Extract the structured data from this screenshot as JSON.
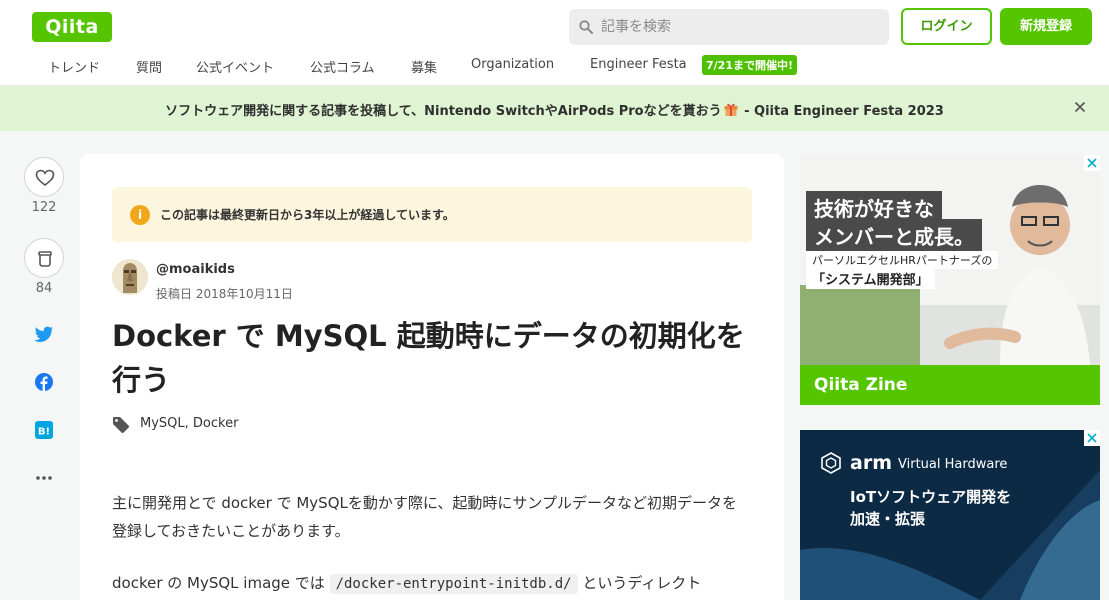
{
  "header": {
    "logo": "Qiita",
    "search_placeholder": "記事を検索",
    "login": "ログイン",
    "signup": "新規登録",
    "nav": [
      "トレンド",
      "質問",
      "公式イベント",
      "公式コラム",
      "募集",
      "Organization",
      "Engineer Festa"
    ],
    "fest_badge": "7/21まで開催中!"
  },
  "banner": {
    "text_before": "ソフトウェア開発に関する記事を投稿して、Nintendo SwitchやAirPods Proなどを貰おう",
    "text_after": " - Qiita Engineer Festa 2023"
  },
  "side": {
    "like_count": "122",
    "stock_count": "84"
  },
  "article": {
    "notice": "この記事は最終更新日から3年以上が経過しています。",
    "author": "@moaikids",
    "posted": "投稿日 2018年10月11日",
    "title": "Docker で MySQL 起動時にデータの初期化を行う",
    "tags": [
      "MySQL",
      "Docker"
    ],
    "para1": "主に開発用とで docker で MySQLを動かす際に、起動時にサンプルデータなど初期データを登録しておきたいことがあります。",
    "para2_before": "docker の MySQL image では ",
    "para2_code": "/docker-entrypoint-initdb.d/",
    "para2_after": " というディレクト"
  },
  "ads": {
    "ad1": {
      "headline1": "技術が好きな",
      "headline2": "メンバーと成長。",
      "sub1": "パーソルエクセルHRパートナーズの",
      "sub2": "「システム開発部」",
      "brand": "Qiita Zine"
    },
    "ad2": {
      "brand": "arm",
      "brand_sub": "Virtual Hardware",
      "line1": "IoTソフトウェア開発を",
      "line2": "加速・拡張"
    }
  },
  "colors": {
    "brand": "#55c500",
    "banner_bg": "#dff4d3",
    "notice_bg": "#fcf6de"
  }
}
